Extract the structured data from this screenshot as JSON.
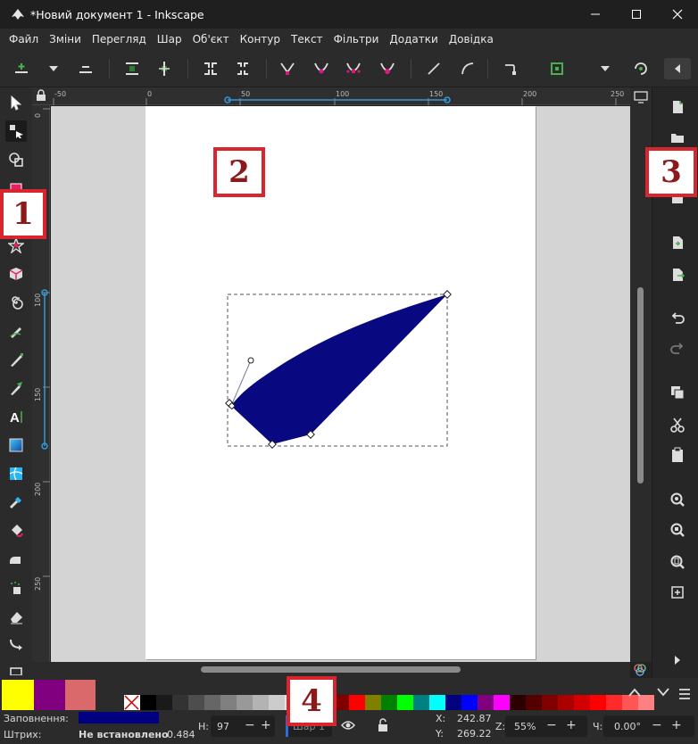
{
  "window": {
    "title": "*Новий документ 1 - Inkscape",
    "controls": [
      "minimize-icon",
      "maximize-icon",
      "close-icon"
    ]
  },
  "menu": [
    "Файл",
    "Зміни",
    "Перегляд",
    "Шар",
    "Об'єкт",
    "Контур",
    "Текст",
    "Фільтри",
    "Додатки",
    "Довідка"
  ],
  "tool_controls": [
    "insert-node-icon",
    "insert-node-dropdown-icon",
    "delete-node-icon",
    "join-nodes-icon",
    "break-path-icon",
    "join-segment-icon",
    "delete-segment-icon",
    "cusp-node-icon",
    "smooth-node-icon",
    "symmetric-node-icon",
    "auto-smooth-node-icon",
    "segment-line-icon",
    "segment-curve-icon",
    "object-to-path-icon",
    "stroke-to-path-icon",
    "more-controls-icon",
    "show-handles-icon",
    "collapse-icon"
  ],
  "left_tools": [
    "selector-icon",
    "node-tool-icon",
    "tweak-tool-icon",
    "rect-tool-icon",
    "ellipse-tool-icon",
    "star-tool-icon",
    "3d-box-tool-icon",
    "spiral-tool-icon",
    "pencil-tool-icon",
    "pen-tool-icon",
    "calligraphy-tool-icon",
    "text-tool-icon",
    "gradient-tool-icon",
    "mesh-tool-icon",
    "dropper-tool-icon",
    "paint-bucket-icon",
    "spray-tool-icon",
    "eraser-tool-icon",
    "connector-tool-icon"
  ],
  "ruler": {
    "top_labels": [
      "-50",
      "0",
      "50",
      "100",
      "150",
      "200",
      "250"
    ],
    "left_labels": [
      "0",
      "100",
      "150",
      "200",
      "250"
    ]
  },
  "right_commands": [
    "new-document-icon",
    "open-document-icon",
    "save-document-icon",
    "import-icon",
    "export-icon",
    "undo-icon",
    "redo-icon",
    "copy-icon",
    "cut-icon",
    "paste-icon",
    "zoom-drawing-icon",
    "zoom-selection-icon",
    "zoom-page-icon",
    "zoom-center-icon",
    "expand-icon"
  ],
  "markers": [
    "1",
    "2",
    "3",
    "4"
  ],
  "palette": {
    "fill_color": "#ffff00",
    "swatches": [
      "#ffff00",
      "#800080",
      "#d9696b",
      "none",
      "#000000",
      "#1a1a1a",
      "#333333",
      "#4d4d4d",
      "#666666",
      "#808080",
      "#999999",
      "#b3b3b3",
      "#cccccc",
      "#e6e6e6",
      "#f2f2f2",
      "#ffffff",
      "#800000",
      "#ff0000",
      "#808000",
      "#008000",
      "#00ff00",
      "#008080",
      "#00ffff",
      "#000080",
      "#0000ff",
      "#800080",
      "#ff00ff",
      "#2b0000",
      "#550000",
      "#800000",
      "#aa0000",
      "#d40000",
      "#ff0000",
      "#ff2a2a",
      "#ff5555",
      "#ff8080"
    ]
  },
  "status": {
    "fill_label": "Заповнення:",
    "stroke_label": "Штрих:",
    "stroke_value": "Не встановлено",
    "stroke_width": "0.484",
    "fill_swatch_color": "#000080",
    "h_label": "Н:",
    "h_value": "97",
    "layer_label": "Шар 1",
    "x_label": "X:",
    "x_value": "242.87",
    "y_label": "Y:",
    "y_value": "269.22",
    "z_label": "Z:",
    "zoom_value": "55%",
    "r_label": "Ч:",
    "rotation_value": "0.00°"
  },
  "drawing": {
    "shape_color": "#080880"
  }
}
